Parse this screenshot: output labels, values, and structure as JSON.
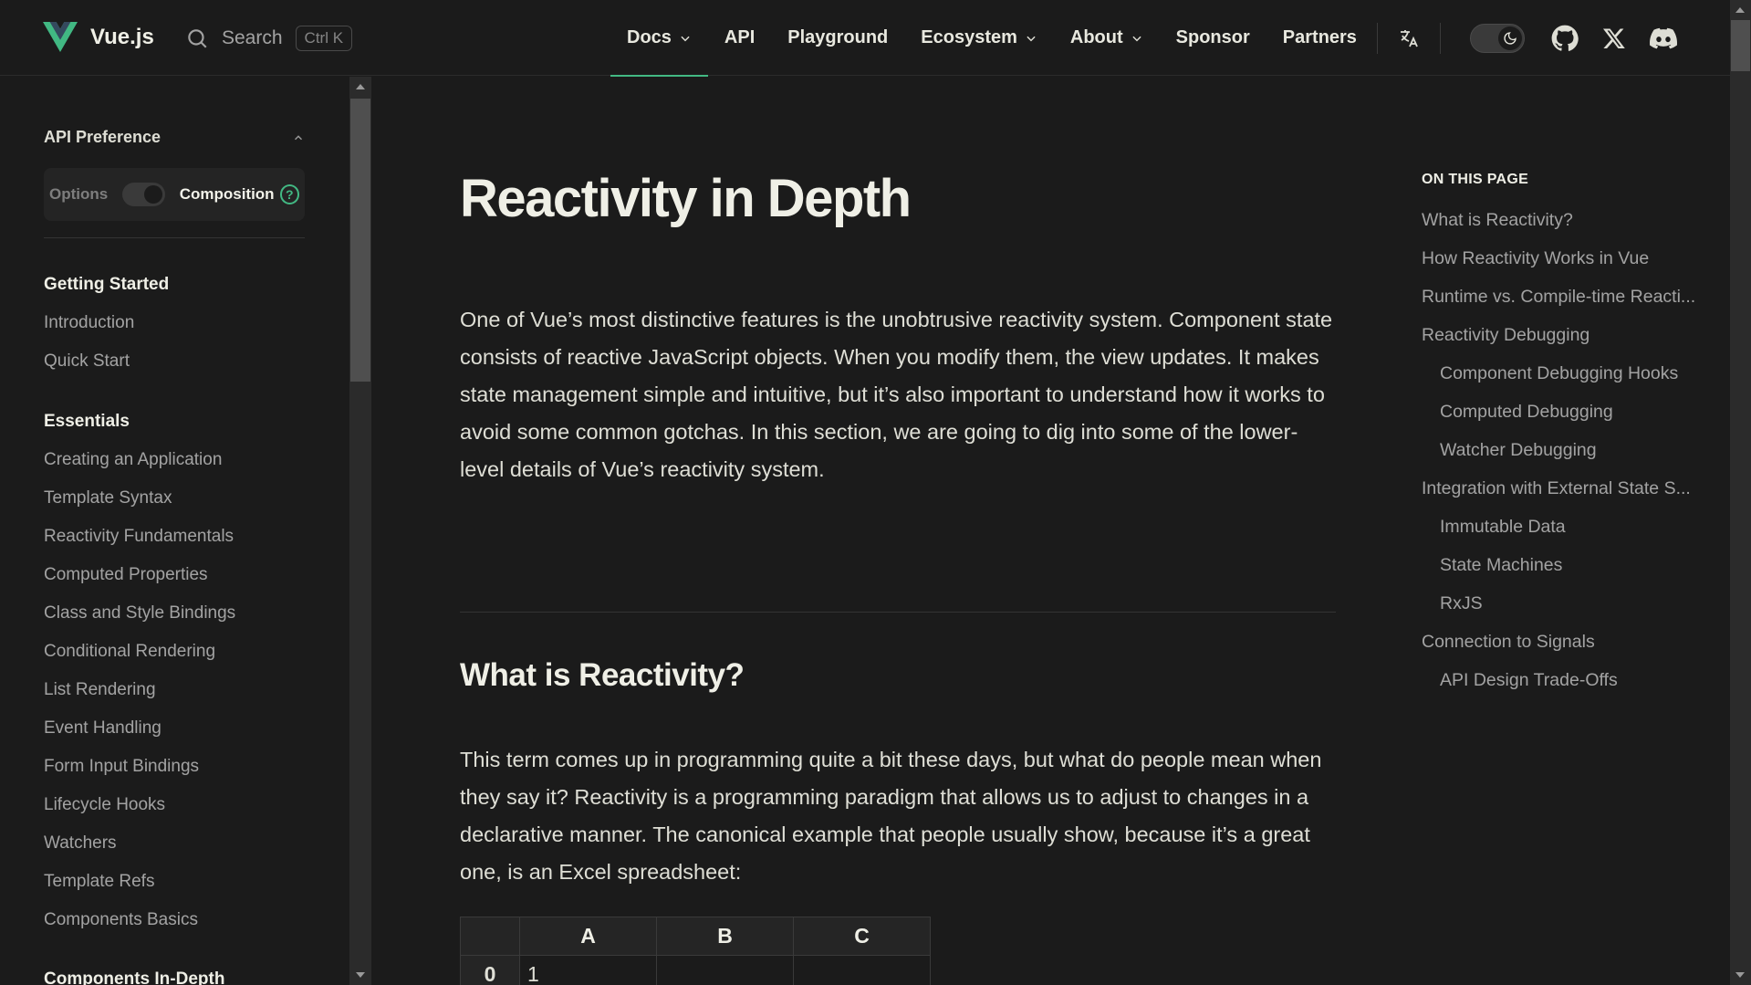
{
  "colors": {
    "background": "#1b1b1b",
    "accent": "#42b883",
    "text": "#fffff5"
  },
  "header": {
    "site_name": "Vue.js",
    "search_label": "Search",
    "search_shortcut": "Ctrl K",
    "menu": [
      {
        "label": "Docs",
        "dropdown": true,
        "active": true
      },
      {
        "label": "API",
        "dropdown": false
      },
      {
        "label": "Playground",
        "dropdown": false
      },
      {
        "label": "Ecosystem",
        "dropdown": true
      },
      {
        "label": "About",
        "dropdown": true
      },
      {
        "label": "Sponsor",
        "dropdown": false
      },
      {
        "label": "Partners",
        "dropdown": false
      }
    ],
    "icons": [
      "translate-icon",
      "moon-icon",
      "github-icon",
      "x-icon",
      "discord-icon"
    ]
  },
  "sidebar": {
    "preference_title": "API Preference",
    "option_label": "Options",
    "composition_label": "Composition",
    "help_glyph": "?",
    "sections": [
      {
        "title": "Getting Started",
        "items": [
          "Introduction",
          "Quick Start"
        ]
      },
      {
        "title": "Essentials",
        "items": [
          "Creating an Application",
          "Template Syntax",
          "Reactivity Fundamentals",
          "Computed Properties",
          "Class and Style Bindings",
          "Conditional Rendering",
          "List Rendering",
          "Event Handling",
          "Form Input Bindings",
          "Lifecycle Hooks",
          "Watchers",
          "Template Refs",
          "Components Basics"
        ]
      },
      {
        "title": "Components In-Depth",
        "items": []
      }
    ]
  },
  "main": {
    "title": "Reactivity in Depth",
    "intro": "One of Vue’s most distinctive features is the unobtrusive reactivity system. Component state consists of reactive JavaScript objects. When you modify them, the view updates. It makes state management simple and intuitive, but it’s also important to understand how it works to avoid some common gotchas. In this section, we are going to dig into some of the lower-level details of Vue’s reactivity system.",
    "section_title": "What is Reactivity?",
    "section_text": "This term comes up in programming quite a bit these days, but what do people mean when they say it? Reactivity is a programming paradigm that allows us to adjust to changes in a declarative manner. The canonical example that people usually show, because it’s a great one, is an Excel spreadsheet:",
    "sheet": {
      "headers": [
        "",
        "A",
        "B",
        "C"
      ],
      "rows": [
        [
          "0",
          "1",
          "",
          ""
        ]
      ]
    }
  },
  "toc": {
    "title": "ON THIS PAGE",
    "items": [
      {
        "label": "What is Reactivity?",
        "level": 1
      },
      {
        "label": "How Reactivity Works in Vue",
        "level": 1
      },
      {
        "label": "Runtime vs. Compile-time Reacti...",
        "level": 1
      },
      {
        "label": "Reactivity Debugging",
        "level": 1
      },
      {
        "label": "Component Debugging Hooks",
        "level": 2
      },
      {
        "label": "Computed Debugging",
        "level": 2
      },
      {
        "label": "Watcher Debugging",
        "level": 2
      },
      {
        "label": "Integration with External State S...",
        "level": 1
      },
      {
        "label": "Immutable Data",
        "level": 2
      },
      {
        "label": "State Machines",
        "level": 2
      },
      {
        "label": "RxJS",
        "level": 2
      },
      {
        "label": "Connection to Signals",
        "level": 1
      },
      {
        "label": "API Design Trade-Offs",
        "level": 2
      }
    ]
  }
}
